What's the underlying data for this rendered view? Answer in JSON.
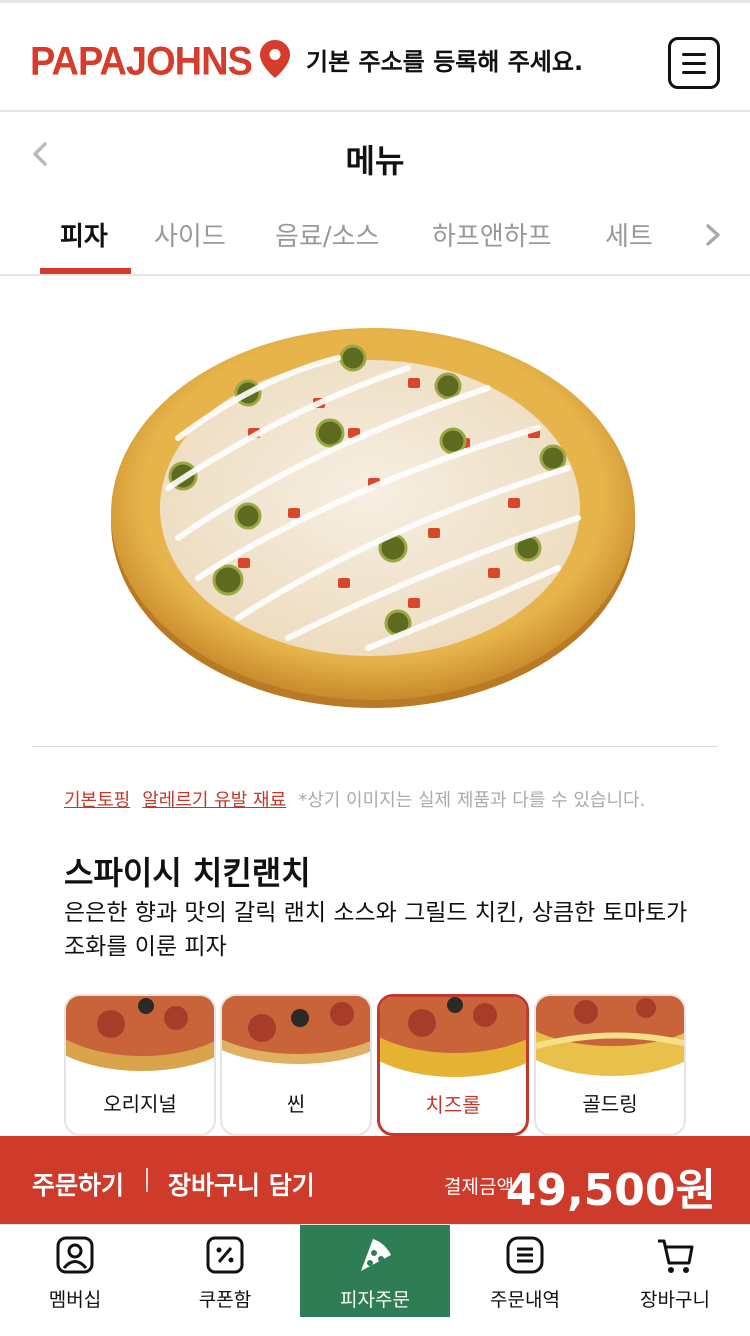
{
  "header": {
    "logo": "PAPAJOHNS",
    "address_prompt": "기본 주소를 등록해 주세요."
  },
  "title_bar": {
    "title": "메뉴"
  },
  "tabs": [
    {
      "label": "피자",
      "active": true
    },
    {
      "label": "사이드"
    },
    {
      "label": "음료/소스"
    },
    {
      "label": "하프앤하프"
    },
    {
      "label": "세트"
    }
  ],
  "product": {
    "links": {
      "basic_topping": "기본토핑",
      "allergen": "알레르기 유발 재료"
    },
    "note": "*상기 이미지는 실제 제품과 다를 수 있습니다.",
    "name": "스파이시 치킨랜치",
    "description": "은은한 향과 맛의 갈릭 랜치 소스와 그릴드 치킨, 상큼한 토마토가 조화를 이룬 피자"
  },
  "crusts": [
    {
      "label": "오리지널"
    },
    {
      "label": "씬"
    },
    {
      "label": "치즈롤",
      "selected": true
    },
    {
      "label": "골드링"
    }
  ],
  "order_bar": {
    "order_label": "주문하기",
    "cart_label": "장바구니 담기",
    "pay_label": "결제금액",
    "amount": "49,500원"
  },
  "bottom_nav": [
    {
      "label": "멤버십",
      "icon": "membership-icon"
    },
    {
      "label": "쿠폰함",
      "icon": "coupon-icon"
    },
    {
      "label": "피자주문",
      "icon": "pizza-slice-icon",
      "active": true
    },
    {
      "label": "주문내역",
      "icon": "order-history-icon"
    },
    {
      "label": "장바구니",
      "icon": "cart-icon"
    }
  ],
  "colors": {
    "brand_red": "#d63c2c",
    "nav_active_green": "#2f7d55"
  }
}
